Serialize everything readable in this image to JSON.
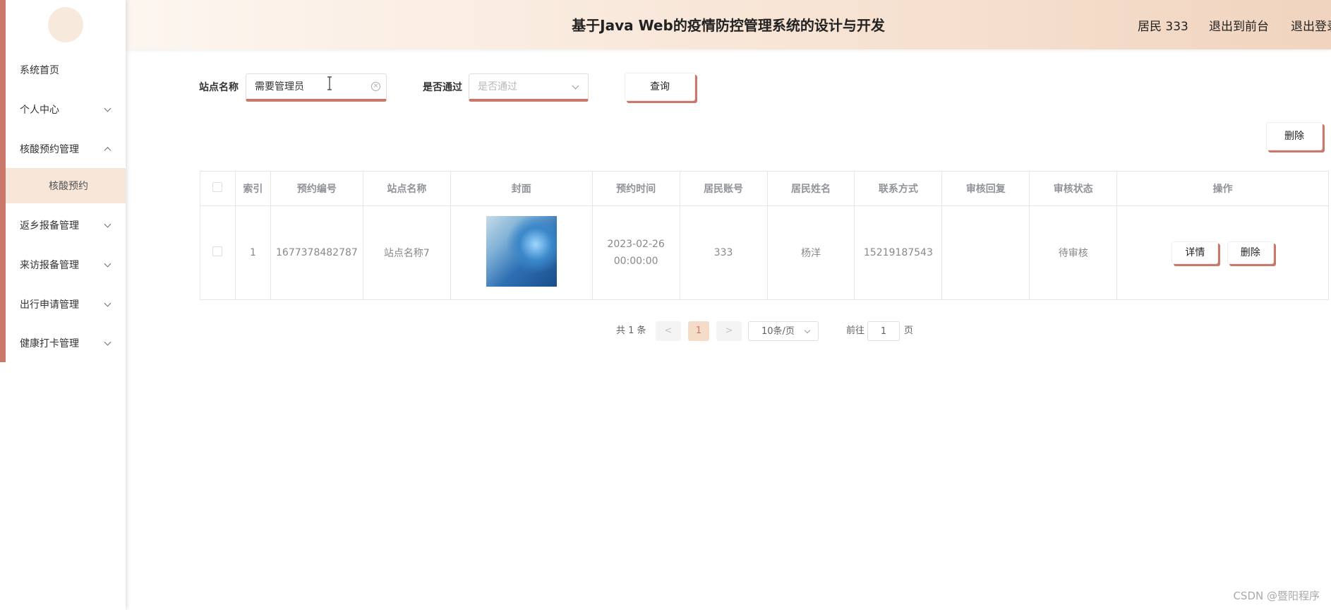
{
  "header": {
    "title": "基于Java Web的疫情防控管理系统的设计与开发",
    "user": "居民 333",
    "to_front": "退出到前台",
    "logout": "退出登录"
  },
  "sidebar": {
    "items": [
      {
        "label": "系统首页"
      },
      {
        "label": "个人中心"
      },
      {
        "label": "核酸预约管理"
      },
      {
        "label": "核酸预约"
      },
      {
        "label": "返乡报备管理"
      },
      {
        "label": "来访报备管理"
      },
      {
        "label": "出行申请管理"
      },
      {
        "label": "健康打卡管理"
      }
    ]
  },
  "search": {
    "station_label": "站点名称",
    "station_value": "需要管理员",
    "passed_label": "是否通过",
    "passed_placeholder": "是否通过",
    "query_button": "查询"
  },
  "toolbar": {
    "delete_button": "删除"
  },
  "table": {
    "headers": [
      "索引",
      "预约编号",
      "站点名称",
      "封面",
      "预约时间",
      "居民账号",
      "居民姓名",
      "联系方式",
      "审核回复",
      "审核状态",
      "操作"
    ],
    "rows": [
      {
        "index": "1",
        "booking_no": "1677378482787",
        "station": "站点名称7",
        "time": "2023-02-26 00:00:00",
        "account": "333",
        "name": "杨洋",
        "phone": "15219187543",
        "reply": "",
        "status": "待审核",
        "detail_button": "详情",
        "delete_button": "删除"
      }
    ]
  },
  "pagination": {
    "total": "共 1 条",
    "prev": "<",
    "current_page": "1",
    "next": ">",
    "page_size": "10条/页",
    "goto_prefix": "前往",
    "goto_value": "1",
    "goto_suffix": "页"
  },
  "watermark": "CSDN @暨阳程序",
  "colors": {
    "accent": "#c9786a",
    "header_start": "#fdf6f0",
    "header_end": "#f0d4bf",
    "submenu_bg": "#f8e7d9"
  }
}
